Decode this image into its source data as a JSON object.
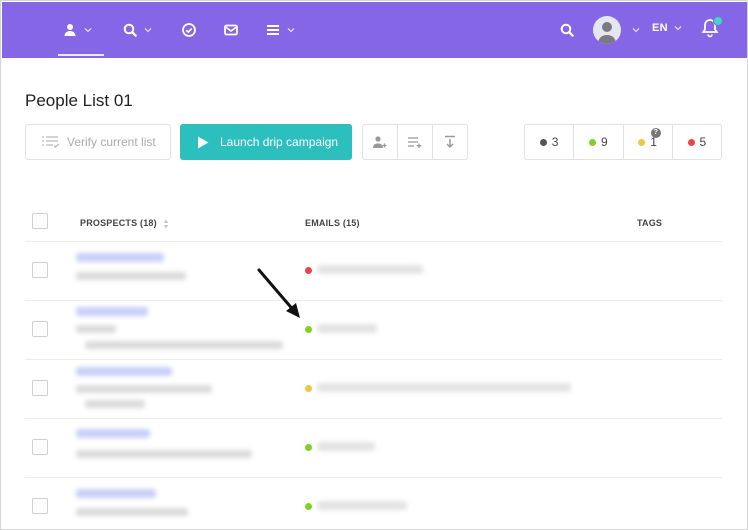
{
  "header": {
    "nav": [
      {
        "icon": "person-icon",
        "has_caret": true,
        "active": true
      },
      {
        "icon": "search-icon",
        "has_caret": true
      },
      {
        "icon": "check-circle-icon",
        "has_caret": false
      },
      {
        "icon": "mail-icon",
        "has_caret": false
      },
      {
        "icon": "menu-icon",
        "has_caret": true
      }
    ],
    "language": "EN",
    "accent_color": "#8566e6",
    "notification_dot_color": "#3ed6c4"
  },
  "page": {
    "title": "People List 01"
  },
  "toolbar": {
    "verify_label": "Verify current list",
    "launch_label": "Launch drip campaign",
    "launch_color": "#2bbfbe",
    "action_icons": [
      "add-person-icon",
      "add-to-list-icon",
      "export-icon"
    ]
  },
  "status_counts": [
    {
      "color": "#555555",
      "count": "3"
    },
    {
      "color": "#7ed321",
      "count": "9"
    },
    {
      "color": "#f5c542",
      "count": "1",
      "badge": "?"
    },
    {
      "color": "#ef4444",
      "count": "5"
    }
  ],
  "table": {
    "columns": {
      "prospects": "PROSPECTS (18)",
      "emails": "EMAILS (15)",
      "tags": "TAGS"
    },
    "rows": [
      {
        "email_status_color": "#ef4444"
      },
      {
        "email_status_color": "#7ed321"
      },
      {
        "email_status_color": "#f5c542"
      },
      {
        "email_status_color": "#7ed321"
      },
      {
        "email_status_color": "#7ed321"
      }
    ]
  }
}
